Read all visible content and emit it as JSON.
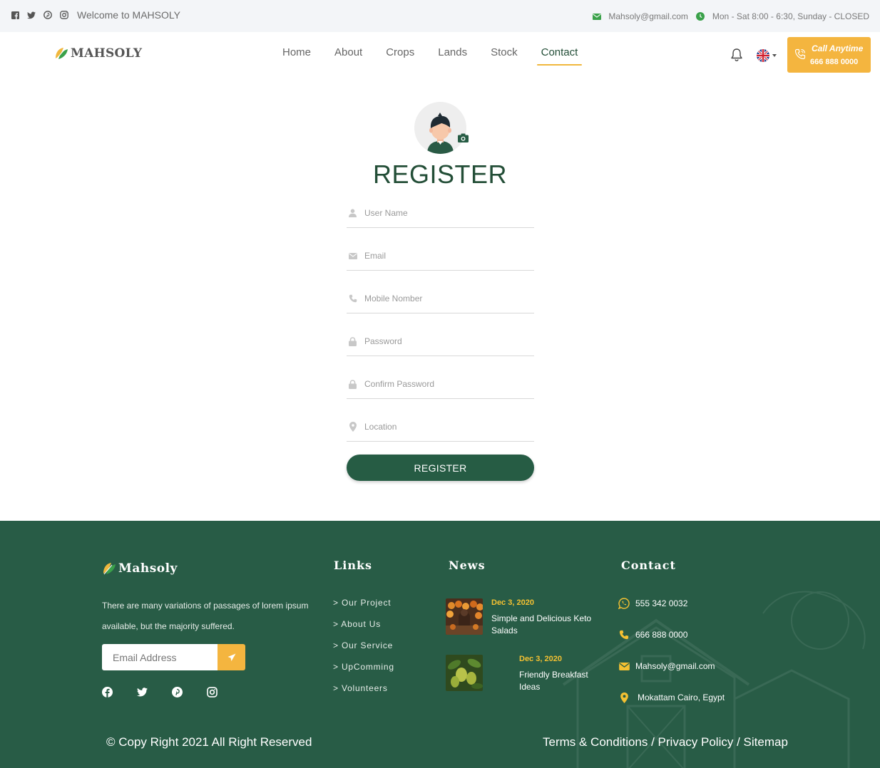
{
  "topbar": {
    "welcome": "Welcome to MAHSOLY",
    "email": "Mahsoly@gmail.com",
    "hours": "Mon - Sat 8:00 - 6:30, Sunday - CLOSED"
  },
  "nav": {
    "logo": "MAHSOLY",
    "items": [
      {
        "label": "Home"
      },
      {
        "label": "About"
      },
      {
        "label": "Crops"
      },
      {
        "label": "Lands"
      },
      {
        "label": "Stock"
      },
      {
        "label": "Contact",
        "active": true
      }
    ],
    "call": {
      "label": "Call Anytime",
      "number": "666 888 0000"
    }
  },
  "register": {
    "title": "REGISTER",
    "fields": [
      {
        "placeholder": "User Name",
        "icon": "user-icon"
      },
      {
        "placeholder": "Email",
        "icon": "envelope-icon"
      },
      {
        "placeholder": "Mobile Nomber",
        "icon": "phone-icon"
      },
      {
        "placeholder": "Password",
        "icon": "lock-icon"
      },
      {
        "placeholder": "Confirm Password",
        "icon": "lock-icon"
      },
      {
        "placeholder": "Location",
        "icon": "map-pin-icon"
      }
    ],
    "button": "REGISTER"
  },
  "footer": {
    "logo": "Mahsoly",
    "description": "There are many variations of passages of lorem ipsum available, but the majority suffered.",
    "subscribe_placeholder": "Email Address",
    "links_title": "Links",
    "links": [
      "> Our Project",
      "> About Us",
      "> Our Service",
      "> UpComming",
      "> Volunteers"
    ],
    "news_title": "News",
    "news": [
      {
        "date": "Dec 3, 2020",
        "title": "Simple and Delicious Keto Salads"
      },
      {
        "date": "Dec 3, 2020",
        "title": "Friendly Breakfast Ideas"
      }
    ],
    "contact_title": "Contact",
    "contact": {
      "whatsapp": "555 342 0032",
      "phone": "666 888 0000",
      "email": "Mahsoly@gmail.com",
      "address": "Mokattam Cairo, Egypt"
    },
    "copyright": "© Copy Right 2021 All Right Reserved",
    "legal": "Terms & Conditions / Privacy Policy / Sitemap"
  },
  "colors": {
    "primary_green": "#285c46",
    "accent_yellow": "#f4b53f",
    "topbar_bg": "#f3f5f8"
  }
}
